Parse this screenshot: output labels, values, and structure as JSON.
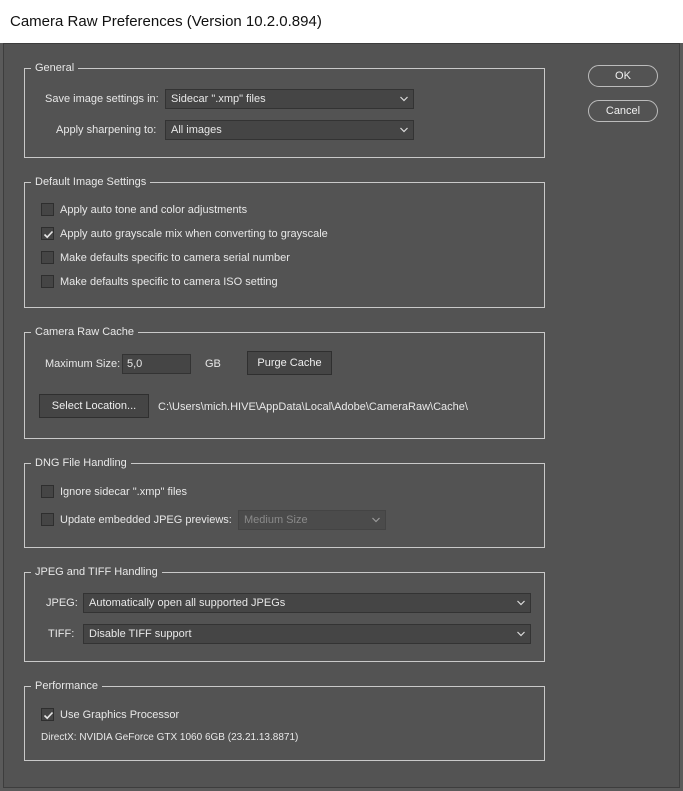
{
  "window": {
    "title": "Camera Raw Preferences  (Version 10.2.0.894)"
  },
  "buttons": {
    "ok": "OK",
    "cancel": "Cancel"
  },
  "general": {
    "legend": "General",
    "save_label": "Save image settings in:",
    "save_value": "Sidecar \".xmp\" files",
    "sharpen_label": "Apply sharpening to:",
    "sharpen_value": "All images"
  },
  "default_settings": {
    "legend": "Default Image Settings",
    "items": [
      {
        "label": "Apply auto tone and color adjustments",
        "checked": false
      },
      {
        "label": "Apply auto grayscale mix when converting to grayscale",
        "checked": true
      },
      {
        "label": "Make defaults specific to camera serial number",
        "checked": false
      },
      {
        "label": "Make defaults specific to camera ISO setting",
        "checked": false
      }
    ]
  },
  "cache": {
    "legend": "Camera Raw Cache",
    "max_label": "Maximum Size:",
    "max_value": "5,0",
    "unit": "GB",
    "purge": "Purge Cache",
    "select_location": "Select Location...",
    "path": "C:\\Users\\mich.HIVE\\AppData\\Local\\Adobe\\CameraRaw\\Cache\\"
  },
  "dng": {
    "legend": "DNG File Handling",
    "ignore_label": "Ignore sidecar \".xmp\" files",
    "ignore_checked": false,
    "update_label": "Update embedded JPEG previews:",
    "update_checked": false,
    "preview_size": "Medium Size"
  },
  "jpeg_tiff": {
    "legend": "JPEG and TIFF Handling",
    "jpeg_label": "JPEG:",
    "jpeg_value": "Automatically open all supported JPEGs",
    "tiff_label": "TIFF:",
    "tiff_value": "Disable TIFF support"
  },
  "performance": {
    "legend": "Performance",
    "gpu_label": "Use Graphics Processor",
    "gpu_checked": true,
    "directx": "DirectX: NVIDIA GeForce GTX 1060 6GB (23.21.13.8871)"
  }
}
